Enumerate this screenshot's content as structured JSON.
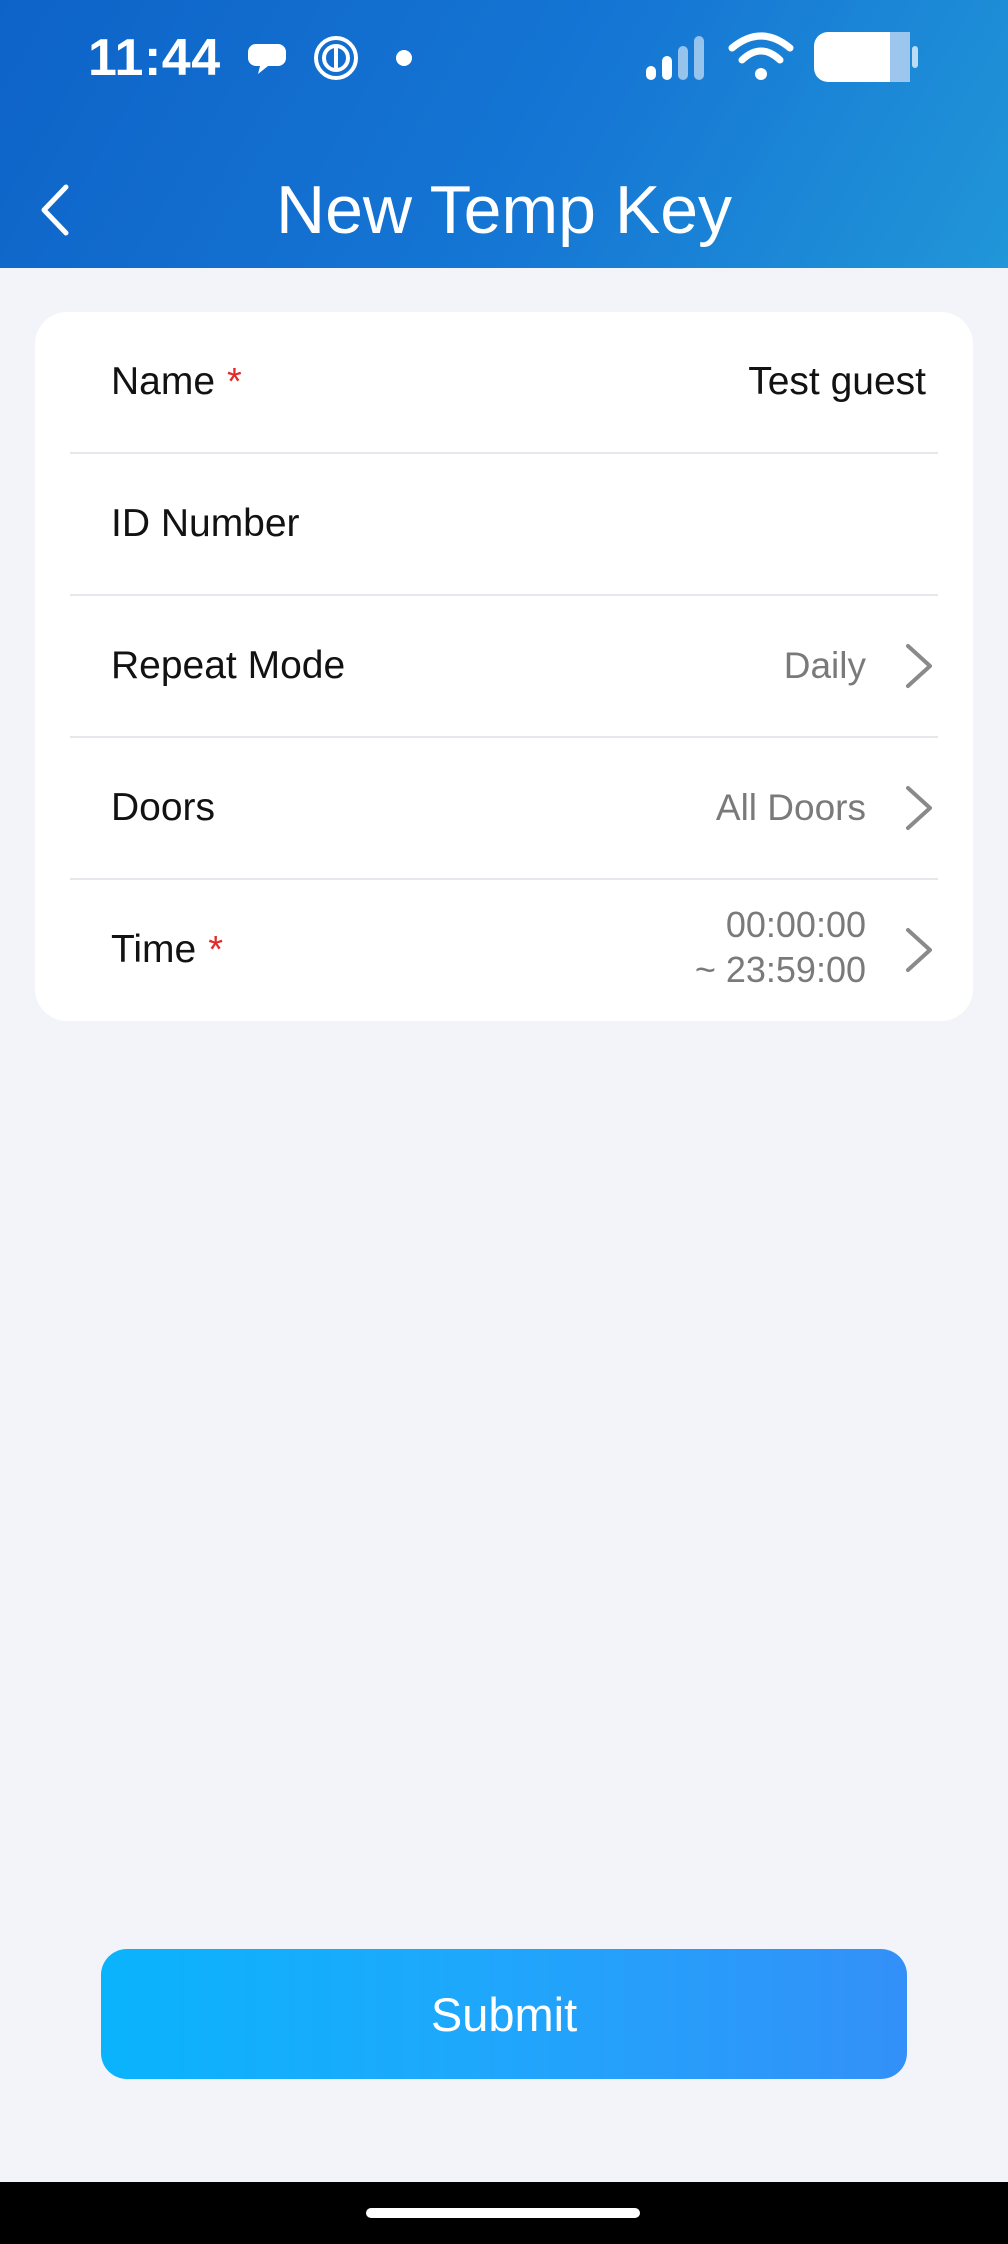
{
  "status_bar": {
    "time": "11:44",
    "icons": [
      "chat-bubble-icon",
      "fingerprint-vpn-icon",
      "notification-dot-icon",
      "signal-icon",
      "wifi-icon",
      "battery-icon"
    ]
  },
  "header": {
    "title": "New Temp Key",
    "back_icon": "chevron-left-icon"
  },
  "form": {
    "rows": [
      {
        "label": "Name",
        "required": true,
        "value": "Test guest"
      },
      {
        "label": "ID Number",
        "required": false,
        "value": ""
      },
      {
        "label": "Repeat Mode",
        "required": false,
        "value": "Daily"
      },
      {
        "label": "Doors",
        "required": false,
        "value": "All Doors"
      },
      {
        "label": "Time",
        "required": true,
        "value_start": "00:00:00",
        "value_end": "~ 23:59:00"
      }
    ],
    "required_marker": "*"
  },
  "submit": {
    "label": "Submit"
  },
  "colors": {
    "header_gradient_start": "#0e63c8",
    "header_gradient_end": "#2196d8",
    "background": "#f2f4f9",
    "required_red": "#e02b2b",
    "button_gradient_start": "#0ab3fc",
    "button_gradient_end": "#3390f8"
  }
}
